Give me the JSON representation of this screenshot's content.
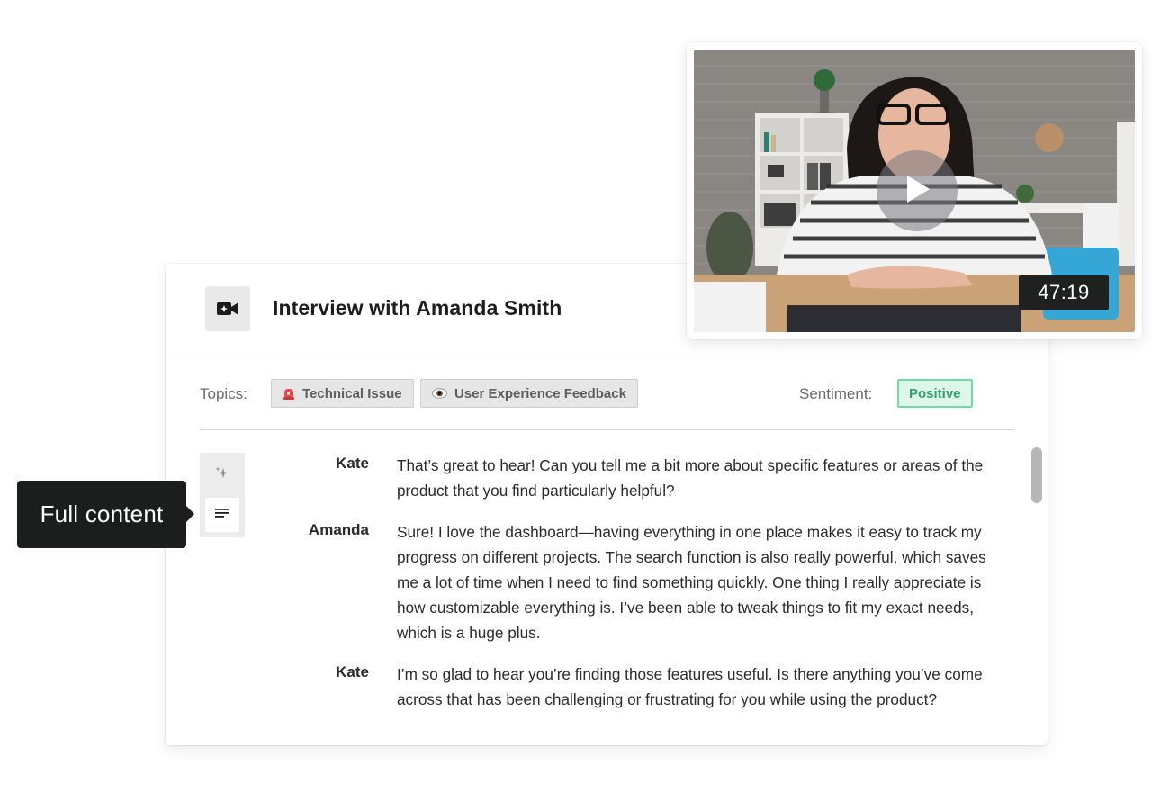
{
  "interview": {
    "title": "Interview with Amanda Smith",
    "header_icon": "video-camera-icon"
  },
  "meta": {
    "topics_label": "Topics:",
    "topics": [
      {
        "label": "Technical Issue",
        "icon": "siren-icon"
      },
      {
        "label": "User Experience Feedback",
        "icon": "eye-icon"
      }
    ],
    "sentiment_label": "Sentiment:",
    "sentiment_value": "Positive",
    "colors": {
      "sentiment_bg": "#dff7ea",
      "sentiment_border": "#6fdba7",
      "sentiment_text": "#31a06a"
    }
  },
  "view_switcher": {
    "options": [
      {
        "icon": "sparkle-icon",
        "active": false
      },
      {
        "icon": "text-lines-icon",
        "active": true
      }
    ],
    "tooltip": "Full content"
  },
  "transcript": [
    {
      "speaker": "Kate",
      "text": "That’s great to hear! Can you tell me a bit more about specific features or areas of the product that you find particularly helpful?"
    },
    {
      "speaker": "Amanda",
      "text": "Sure! I love the dashboard—having everything in one place makes it easy to track my progress on different projects. The search function is also really powerful, which saves me a lot of time when I need to find something quickly. One thing I really appreciate is how customizable everything is. I’ve been able to tweak things to fit my exact needs, which is a huge plus."
    },
    {
      "speaker": "Kate",
      "text": "I’m so glad to hear you’re finding those features useful. Is there anything you’ve come across that has been challenging or frustrating for you while using the product?"
    }
  ],
  "video": {
    "duration": "47:19",
    "play_icon": "play-icon"
  }
}
